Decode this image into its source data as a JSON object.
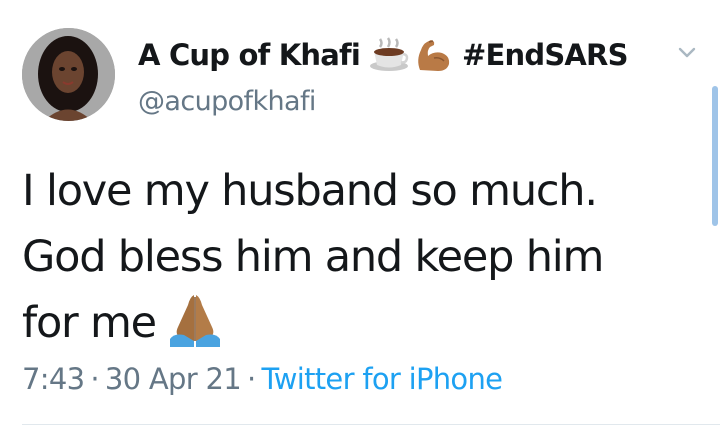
{
  "author": {
    "display_name": "A Cup of Khafi",
    "name_emoji_1": "hot-beverage-emoji",
    "name_emoji_2": "flexed-biceps-emoji",
    "hashtag": "#EndSARS",
    "handle": "@acupofkhafi",
    "avatar": "profile-photo"
  },
  "tweet": {
    "lines": [
      "I love my husband so much.",
      "God bless him and keep him",
      "for me"
    ],
    "trailing_emoji": "folded-hands-emoji"
  },
  "meta": {
    "time": "7:43",
    "separator": "·",
    "date": "30 Apr 21",
    "source": "Twitter for iPhone"
  },
  "icons": {
    "more_options": "chevron-down-icon"
  },
  "colors": {
    "text_primary": "#14171a",
    "text_secondary": "#657786",
    "link": "#1da1f2",
    "divider": "#e1e8ed"
  }
}
